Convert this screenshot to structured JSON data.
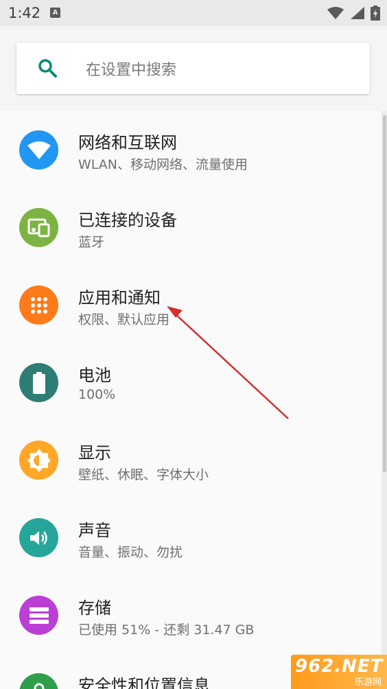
{
  "status_bar": {
    "time": "1:42",
    "notif_glyph": "A",
    "icons": [
      "wifi-icon",
      "signal-icon",
      "battery-charging-icon"
    ]
  },
  "search": {
    "placeholder": "在设置中搜索",
    "icon": "search-icon",
    "accent": "#00897b"
  },
  "settings": [
    {
      "title": "网络和互联网",
      "subtitle": "WLAN、移动网络、流量使用",
      "icon": "wifi-icon",
      "color": "#2196f3"
    },
    {
      "title": "已连接的设备",
      "subtitle": "蓝牙",
      "icon": "devices-icon",
      "color": "#7cb342"
    },
    {
      "title": "应用和通知",
      "subtitle": "权限、默认应用",
      "icon": "apps-grid-icon",
      "color": "#ff7a1a"
    },
    {
      "title": "电池",
      "subtitle": "100%",
      "icon": "battery-icon",
      "color": "#2e7d74"
    },
    {
      "title": "显示",
      "subtitle": "壁纸、休眠、字体大小",
      "icon": "brightness-icon",
      "color": "#ffa726"
    },
    {
      "title": "声音",
      "subtitle": "音量、振动、勿扰",
      "icon": "volume-icon",
      "color": "#26a69a"
    },
    {
      "title": "存储",
      "subtitle": "已使用 51% - 还剩 31.47 GB",
      "icon": "storage-icon",
      "color": "#ba3fd4"
    },
    {
      "title": "安全性和位置信息",
      "subtitle": "",
      "icon": "lock-icon",
      "color": "#2e9e4a"
    }
  ],
  "annotation": {
    "color": "#d32f2f"
  },
  "watermark": {
    "main": "962.NET",
    "sub": "乐游网"
  }
}
